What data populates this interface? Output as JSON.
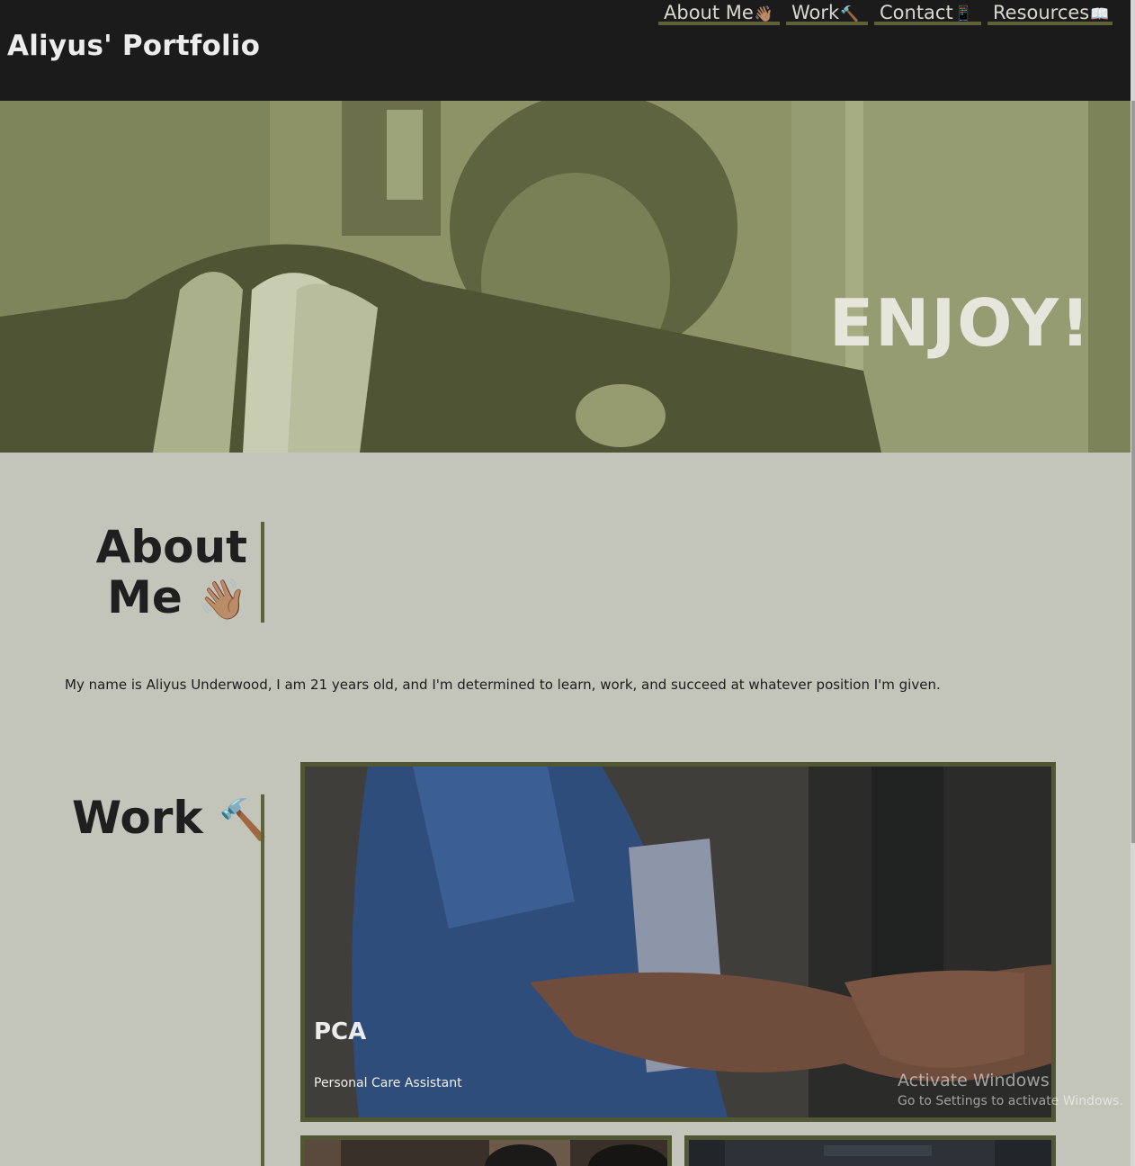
{
  "header": {
    "brand": "Aliyus' Portfolio",
    "nav": [
      {
        "label": "About Me",
        "emoji": "👋🏽"
      },
      {
        "label": "Work",
        "emoji": "🔨"
      },
      {
        "label": "Contact",
        "emoji": "📱"
      },
      {
        "label": "Resources",
        "emoji": "📖"
      }
    ]
  },
  "hero": {
    "title": "ENJOY!"
  },
  "about": {
    "heading_line1": "About",
    "heading_line2": "Me",
    "heading_emoji": "👋🏽",
    "text": "My name is Aliyus Underwood, I am 21 years old, and I'm determined to learn, work, and succeed at whatever position I'm given."
  },
  "work": {
    "heading": "Work",
    "heading_emoji": "🔨",
    "cards": [
      {
        "title": "PCA",
        "subtitle": "Personal Care Assistant"
      }
    ]
  },
  "watermark": {
    "title": "Activate Windows",
    "subtitle": "Go to Settings to activate Windows."
  },
  "colors": {
    "header_bg": "#1b1b1b",
    "page_bg": "#c3c5ba",
    "accent_olive": "#5e6239",
    "hero_tint": "#8f9569"
  }
}
